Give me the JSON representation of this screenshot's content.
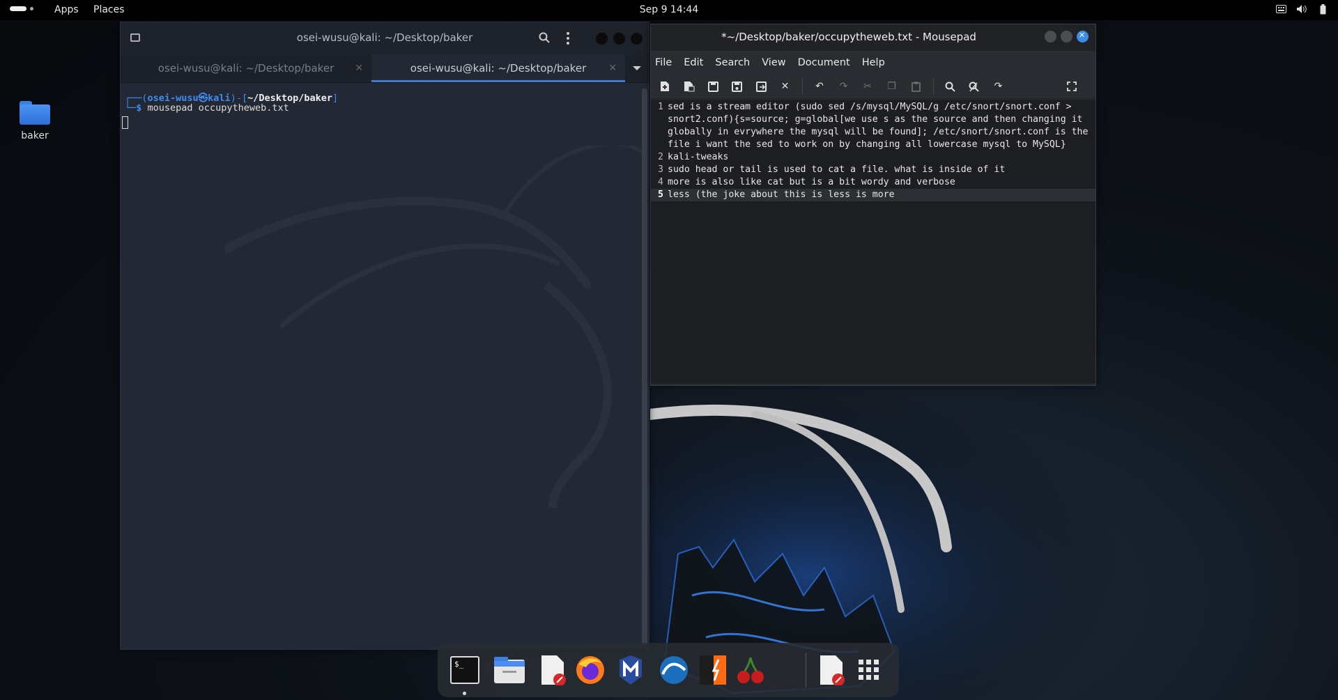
{
  "topbar": {
    "apps_label": "Apps",
    "places_label": "Places",
    "clock": "Sep 9  14:44"
  },
  "desktop": {
    "folder_label": "baker"
  },
  "terminal": {
    "title": "osei-wusu@kali: ~/Desktop/baker",
    "tabs": [
      {
        "label": "osei-wusu@kali: ~/Desktop/baker",
        "active": false
      },
      {
        "label": "osei-wusu@kali: ~/Desktop/baker",
        "active": true
      }
    ],
    "prompt": {
      "open": "┌──(",
      "user": "osei-wusu㉿kali",
      "mid": ")-[",
      "path": "~/Desktop/baker",
      "close": "]",
      "line2_prefix": "└─",
      "dollar": "$",
      "command": " mousepad occupytheweb.txt"
    }
  },
  "mousepad": {
    "title": "*~/Desktop/baker/occupytheweb.txt - Mousepad",
    "menu": [
      "File",
      "Edit",
      "Search",
      "View",
      "Document",
      "Help"
    ],
    "lines": [
      {
        "num": "1",
        "text": "sed is a stream editor (sudo sed /s/mysql/MySQL/g /etc/snort/snort.conf >"
      },
      {
        "num": "",
        "text": "snort2.conf){s=source; g=global[we use s as the source and then changing it"
      },
      {
        "num": "",
        "text": "globally in evrywhere the mysql will be found]; /etc/snort/snort.conf is the"
      },
      {
        "num": "",
        "text": "file i want the sed to work on by changing all lowercase mysql to MySQL}"
      },
      {
        "num": "2",
        "text": "kali-tweaks"
      },
      {
        "num": "3",
        "text": "sudo head or tail is used to cat a file. what is inside of it"
      },
      {
        "num": "4",
        "text": "more is also like cat but is a bit wordy and verbose"
      },
      {
        "num": "5",
        "text": "less (the joke about this is less is more"
      }
    ]
  },
  "colors": {
    "accent": "#3e7bd4",
    "close_button": "#3a8ee6",
    "prompt_blue": "#3f8cf1"
  },
  "dock": {
    "items": [
      "terminal-icon",
      "file-manager-icon",
      "text-editor-icon",
      "firefox-icon",
      "metasploit-icon",
      "wireshark-icon",
      "burpsuite-icon",
      "cherrytree-icon",
      "text-editor-icon",
      "app-grid-icon"
    ]
  }
}
